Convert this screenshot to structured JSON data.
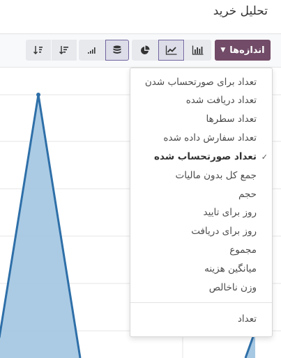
{
  "page": {
    "title": "تحلیل خرید"
  },
  "toolbar": {
    "measures_label": "اندازه‌ها"
  },
  "icons": {
    "bar": "bar-chart-icon",
    "line": "line-chart-icon",
    "pie": "pie-chart-icon",
    "stack": "stack-icon",
    "ascending": "sort-ascending-icon",
    "descending": "sort-descending-icon",
    "desc_sort": "sort-desc-icon"
  },
  "measures_menu": {
    "items": [
      {
        "label": "تعداد برای صورتحساب شدن",
        "selected": false
      },
      {
        "label": "تعداد دریافت شده",
        "selected": false
      },
      {
        "label": "تعداد سطرها",
        "selected": false
      },
      {
        "label": "تعداد سفارش داده شده",
        "selected": false
      },
      {
        "label": "تعداد صورتحساب شده",
        "selected": true
      },
      {
        "label": "جمع کل بدون مالیات",
        "selected": false
      },
      {
        "label": "حجم",
        "selected": false
      },
      {
        "label": "روز برای تایید",
        "selected": false
      },
      {
        "label": "روز برای دریافت",
        "selected": false
      },
      {
        "label": "مجموع",
        "selected": false
      },
      {
        "label": "میانگین هزینه",
        "selected": false
      },
      {
        "label": "وزن ناخالص",
        "selected": false
      }
    ],
    "count_label": "تعداد",
    "check_glyph": "✓"
  },
  "colors": {
    "accent": "#714b67",
    "line": "#1f77b4",
    "fill": "#a6c8e3",
    "active_border": "#71639e"
  }
}
